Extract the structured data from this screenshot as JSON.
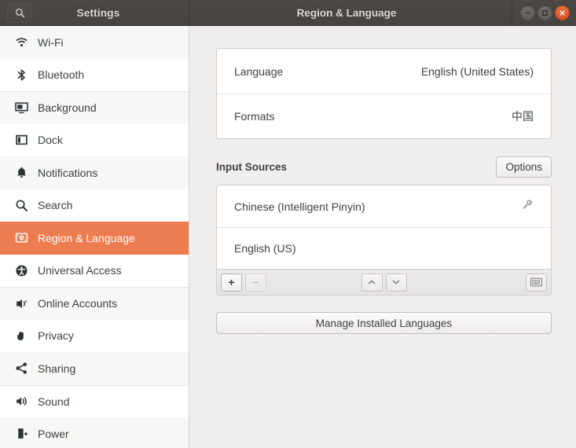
{
  "titlebar": {
    "sidebar_title": "Settings",
    "content_title": "Region & Language",
    "search_icon": "search-icon",
    "minimize_label": "Minimize",
    "maximize_label": "Maximize",
    "close_label": "Close"
  },
  "sidebar": {
    "items": [
      {
        "label": "Wi-Fi",
        "icon": "wifi-icon",
        "selected": false
      },
      {
        "label": "Bluetooth",
        "icon": "bluetooth-icon",
        "selected": false
      },
      {
        "label": "Background",
        "icon": "background-icon",
        "selected": false
      },
      {
        "label": "Dock",
        "icon": "dock-icon",
        "selected": false
      },
      {
        "label": "Notifications",
        "icon": "bell-icon",
        "selected": false
      },
      {
        "label": "Search",
        "icon": "search-icon",
        "selected": false
      },
      {
        "label": "Region & Language",
        "icon": "region-language-icon",
        "selected": true
      },
      {
        "label": "Universal Access",
        "icon": "universal-access-icon",
        "selected": false
      },
      {
        "label": "Online Accounts",
        "icon": "online-accounts-icon",
        "selected": false
      },
      {
        "label": "Privacy",
        "icon": "privacy-hand-icon",
        "selected": false
      },
      {
        "label": "Sharing",
        "icon": "sharing-icon",
        "selected": false
      },
      {
        "label": "Sound",
        "icon": "sound-icon",
        "selected": false
      },
      {
        "label": "Power",
        "icon": "power-icon",
        "selected": false
      }
    ]
  },
  "main": {
    "language_card": [
      {
        "key": "Language",
        "value": "English (United States)"
      },
      {
        "key": "Formats",
        "value": "中国"
      }
    ],
    "input_sources": {
      "title": "Input Sources",
      "options_button": "Options",
      "sources": [
        {
          "label": "Chinese (Intelligent Pinyin)",
          "has_prefs": true
        },
        {
          "label": "English (US)",
          "has_prefs": false
        }
      ],
      "toolbar": {
        "add": "+",
        "remove": "−",
        "move_up": "move-up",
        "move_down": "move-down",
        "show_keyboard_layout": "show-keyboard-layout"
      }
    },
    "manage_languages_button": "Manage Installed Languages"
  },
  "colors": {
    "accent": "#ed7d51",
    "titlebar": "#4c4845",
    "content_bg": "#f0efee",
    "close_button": "#d95426"
  }
}
